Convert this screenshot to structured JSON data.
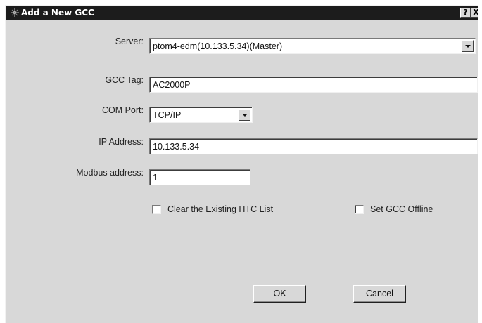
{
  "window": {
    "title": "Add a New GCC",
    "help_label": "?",
    "close_label": "X",
    "title_icon": "app-icon"
  },
  "form": {
    "server": {
      "label": "Server:",
      "value": "ptom4-edm(10.133.5.34)(Master)"
    },
    "gcc_tag": {
      "label": "GCC Tag:",
      "value": "AC2000P"
    },
    "com_port": {
      "label": "COM Port:",
      "value": "TCP/IP"
    },
    "ip_address": {
      "label": "IP Address:",
      "value": "10.133.5.34"
    },
    "modbus_address": {
      "label": "Modbus address:",
      "value": "1"
    },
    "clear_htc_list": {
      "label": "Clear the Existing HTC List",
      "checked": false
    },
    "set_offline": {
      "label": "Set GCC Offline",
      "checked": false
    }
  },
  "buttons": {
    "ok_label": "OK",
    "cancel_label": "Cancel"
  },
  "colors": {
    "titlebar": "#1c1c1c",
    "dialog_background": "#d8d8d8",
    "field_background": "#ffffff"
  }
}
